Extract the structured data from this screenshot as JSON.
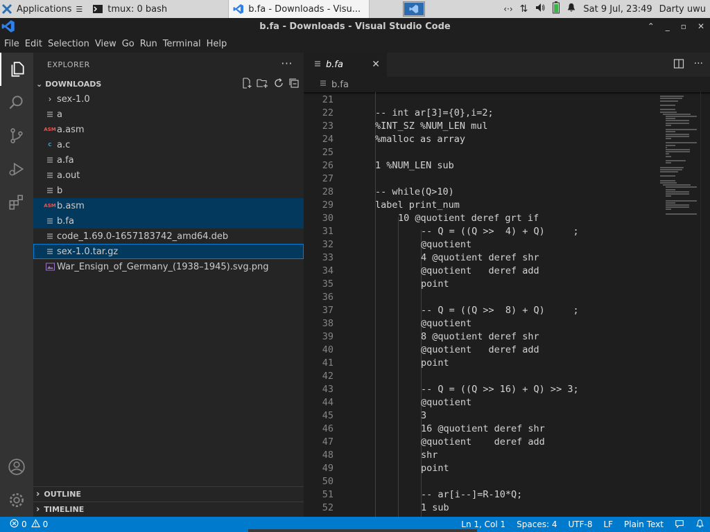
{
  "panel": {
    "apps_label": "Applications",
    "tasks": [
      {
        "label": "tmux: 0 bash"
      },
      {
        "label": "b.fa - Downloads - Visu..."
      }
    ],
    "clock": "Sat  9 Jul, 23:49",
    "user": "Darty uwu"
  },
  "window": {
    "title": "b.fa - Downloads - Visual Studio Code"
  },
  "menu": [
    "File",
    "Edit",
    "Selection",
    "View",
    "Go",
    "Run",
    "Terminal",
    "Help"
  ],
  "sidebar": {
    "header": "EXPLORER",
    "section": "DOWNLOADS",
    "files": [
      {
        "name": "sex-1.0",
        "icon": "chevron-right-icon"
      },
      {
        "name": "a",
        "icon": "file-lines-icon"
      },
      {
        "name": "a.asm",
        "icon": "asm-file-icon",
        "badge": "ASM"
      },
      {
        "name": "a.c",
        "icon": "c-file-icon",
        "badge": "C"
      },
      {
        "name": "a.fa",
        "icon": "file-lines-icon"
      },
      {
        "name": "a.out",
        "icon": "file-lines-icon"
      },
      {
        "name": "b",
        "icon": "file-lines-icon"
      },
      {
        "name": "b.asm",
        "icon": "asm-file-icon",
        "badge": "ASM"
      },
      {
        "name": "b.fa",
        "icon": "file-lines-icon"
      },
      {
        "name": "code_1.69.0-1657183742_amd64.deb",
        "icon": "file-lines-icon"
      },
      {
        "name": "sex-1.0.tar.gz",
        "icon": "file-lines-icon"
      },
      {
        "name": "War_Ensign_of_Germany_(1938–1945).svg.png",
        "icon": "image-file-icon"
      }
    ],
    "outline": "OUTLINE",
    "timeline": "TIMELINE"
  },
  "editor": {
    "tab": "b.fa",
    "breadcrumb": "b.fa",
    "lines": [
      {
        "n": "21",
        "indent": 0,
        "text": ""
      },
      {
        "n": "22",
        "indent": 0,
        "text": "-- int ar[3]={0},i=2;"
      },
      {
        "n": "23",
        "indent": 0,
        "text": "%INT_SZ %NUM_LEN mul"
      },
      {
        "n": "24",
        "indent": 0,
        "text": "%malloc as array"
      },
      {
        "n": "25",
        "indent": 0,
        "text": ""
      },
      {
        "n": "26",
        "indent": 0,
        "text": "1 %NUM_LEN sub"
      },
      {
        "n": "27",
        "indent": 0,
        "text": ""
      },
      {
        "n": "28",
        "indent": 0,
        "text": "-- while(Q>10)"
      },
      {
        "n": "29",
        "indent": 0,
        "text": "label print_num"
      },
      {
        "n": "30",
        "indent": 1,
        "text": "10 @quotient deref grt if"
      },
      {
        "n": "31",
        "indent": 2,
        "text": "-- Q = ((Q >>  4) + Q)     ;"
      },
      {
        "n": "32",
        "indent": 2,
        "text": "@quotient"
      },
      {
        "n": "33",
        "indent": 2,
        "text": "4 @quotient deref shr"
      },
      {
        "n": "34",
        "indent": 2,
        "text": "@quotient   deref add"
      },
      {
        "n": "35",
        "indent": 2,
        "text": "point"
      },
      {
        "n": "36",
        "indent": 2,
        "text": ""
      },
      {
        "n": "37",
        "indent": 2,
        "text": "-- Q = ((Q >>  8) + Q)     ;"
      },
      {
        "n": "38",
        "indent": 2,
        "text": "@quotient"
      },
      {
        "n": "39",
        "indent": 2,
        "text": "8 @quotient deref shr"
      },
      {
        "n": "40",
        "indent": 2,
        "text": "@quotient   deref add"
      },
      {
        "n": "41",
        "indent": 2,
        "text": "point"
      },
      {
        "n": "42",
        "indent": 2,
        "text": ""
      },
      {
        "n": "43",
        "indent": 2,
        "text": "-- Q = ((Q >> 16) + Q) >> 3;"
      },
      {
        "n": "44",
        "indent": 2,
        "text": "@quotient"
      },
      {
        "n": "45",
        "indent": 2,
        "text": "3"
      },
      {
        "n": "46",
        "indent": 2,
        "text": "16 @quotient deref shr"
      },
      {
        "n": "47",
        "indent": 2,
        "text": "@quotient    deref add"
      },
      {
        "n": "48",
        "indent": 2,
        "text": "shr"
      },
      {
        "n": "49",
        "indent": 2,
        "text": "point"
      },
      {
        "n": "50",
        "indent": 2,
        "text": ""
      },
      {
        "n": "51",
        "indent": 2,
        "text": "-- ar[i--]=R-10*Q;"
      },
      {
        "n": "52",
        "indent": 2,
        "text": "1 sub"
      }
    ]
  },
  "status": {
    "errors": "0",
    "warnings": "0",
    "position": "Ln 1, Col 1",
    "spaces": "Spaces: 4",
    "encoding": "UTF-8",
    "eol": "LF",
    "language": "Plain Text"
  },
  "colors": {
    "accent": "#007acc",
    "selection": "#04395e",
    "focus_border": "#007fd4",
    "asm_icon": "#e05a5a",
    "c_icon": "#519aba"
  }
}
